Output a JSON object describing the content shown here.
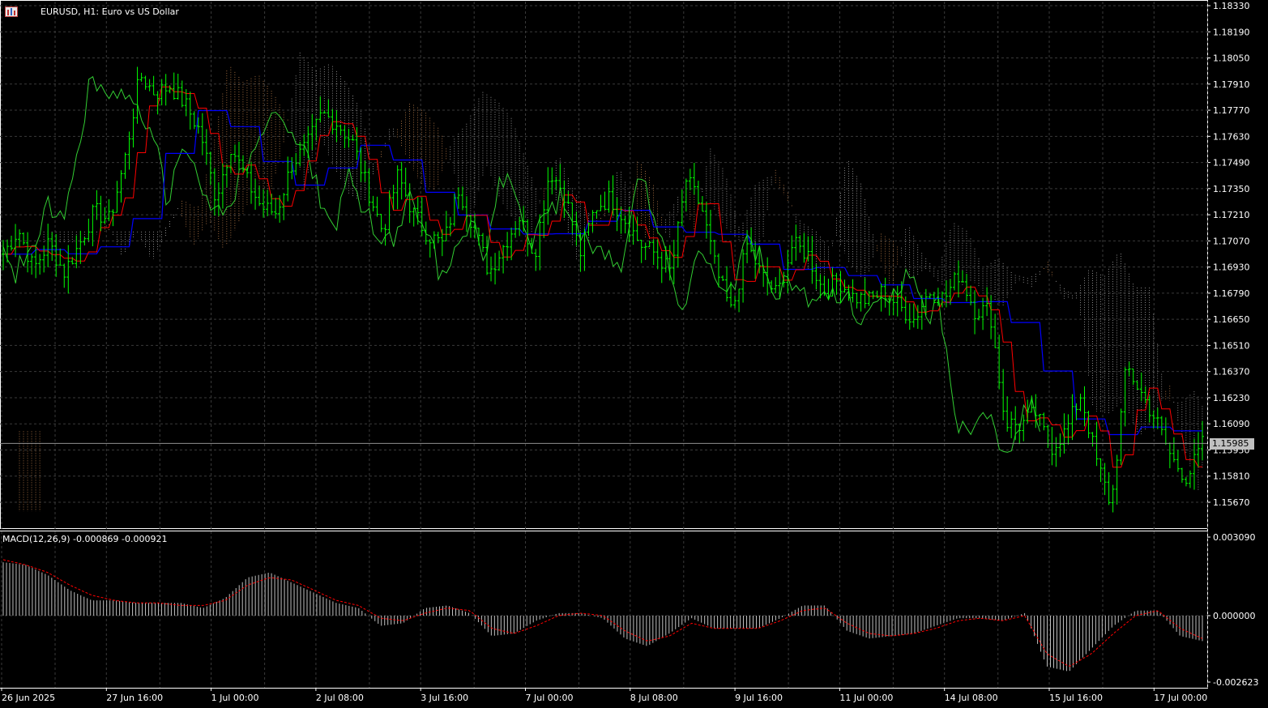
{
  "window": {
    "symbol_title": "EURUSD, H1:  Euro vs US Dollar",
    "icons": [
      "chart-window-icon",
      "bar-chart-icon"
    ]
  },
  "colors": {
    "background": "#000000",
    "grid": "#3a3a3a",
    "price": "#00ff00",
    "tenkan": "#ff0000",
    "kijun": "#0000ff",
    "chikou": "#32cd32",
    "cloud_a": "#f4a460",
    "cloud_b": "#d8d8d8",
    "macd_hist": "#c0c0c0",
    "macd_signal": "#ff0000",
    "axis_text": "#ffffff"
  },
  "macd": {
    "label": "MACD(12,26,9) -0.000869 -0.000921",
    "y_labels": [
      "0.003090",
      "0.000000",
      "-0.002623"
    ]
  },
  "current_price_tag": "1.15985",
  "chart_data": {
    "type": "candlestick",
    "symbol": "EURUSD",
    "timeframe": "H1",
    "title": "EURUSD, H1:  Euro vs US Dollar",
    "y_axis_labels": [
      "1.18330",
      "1.18190",
      "1.18050",
      "1.17910",
      "1.17770",
      "1.17630",
      "1.17490",
      "1.17350",
      "1.17210",
      "1.17070",
      "1.16930",
      "1.16790",
      "1.16650",
      "1.16510",
      "1.16370",
      "1.16230",
      "1.16090",
      "1.15950",
      "1.15810",
      "1.15670"
    ],
    "ylim": [
      1.1555,
      1.184
    ],
    "x_axis_labels": [
      "26 Jun 2025",
      "27 Jun 16:00",
      "1 Jul 00:00",
      "2 Jul 08:00",
      "3 Jul 16:00",
      "7 Jul 00:00",
      "8 Jul 08:00",
      "9 Jul 16:00",
      "11 Jul 00:00",
      "14 Jul 08:00",
      "15 Jul 16:00",
      "17 Jul 00:00"
    ],
    "current_price": 1.15985,
    "price_path": [
      1.17,
      1.1713,
      1.1692,
      1.1706,
      1.169,
      1.1705,
      1.1723,
      1.1718,
      1.175,
      1.1796,
      1.1786,
      1.179,
      1.178,
      1.1765,
      1.173,
      1.1758,
      1.174,
      1.1725,
      1.1722,
      1.1748,
      1.1758,
      1.1775,
      1.177,
      1.176,
      1.1735,
      1.1712,
      1.1742,
      1.1722,
      1.171,
      1.1705,
      1.1735,
      1.1715,
      1.169,
      1.1705,
      1.172,
      1.17,
      1.1745,
      1.1732,
      1.17,
      1.1725,
      1.173,
      1.1718,
      1.1705,
      1.17,
      1.169,
      1.174,
      1.1725,
      1.169,
      1.1668,
      1.1705,
      1.1688,
      1.1678,
      1.1705,
      1.17,
      1.168,
      1.1686,
      1.1677,
      1.1675,
      1.168,
      1.1672,
      1.1665,
      1.168,
      1.1676,
      1.169,
      1.167,
      1.167,
      1.161,
      1.1608,
      1.1615,
      1.1596,
      1.1605,
      1.1625,
      1.159,
      1.1565,
      1.164,
      1.1625,
      1.161,
      1.159,
      1.158,
      1.1598
    ],
    "macd_histogram": [
      0.0021,
      0.002,
      0.0016,
      0.001,
      0.0006,
      0.0006,
      0.0005,
      0.0005,
      0.0005,
      0.0003,
      0.0007,
      0.0015,
      0.0017,
      0.0013,
      0.0009,
      0.0005,
      0.0003,
      -0.0004,
      -0.0003,
      0.0003,
      0.0004,
      0.0001,
      -0.0008,
      -0.0007,
      -0.0002,
      0.0001,
      0.0001,
      -0.0001,
      -0.0009,
      -0.0012,
      -0.0007,
      -0.0001,
      -0.0005,
      -0.0005,
      -0.0005,
      -0.0001,
      0.0004,
      0.0004,
      -0.0006,
      -0.0009,
      -0.0008,
      -0.0007,
      -0.0004,
      -0.0001,
      -0.0001,
      -0.0002,
      0.0001,
      -0.002,
      -0.0022,
      -0.0013,
      -0.0004,
      0.0002,
      0.0002,
      -0.0008,
      -0.001
    ],
    "macd_signal": [
      0.0022,
      0.002,
      0.0017,
      0.0012,
      0.0008,
      0.0006,
      0.0005,
      0.0005,
      0.0004,
      0.0004,
      0.0006,
      0.0012,
      0.0015,
      0.0014,
      0.001,
      0.0006,
      0.0004,
      -0.0001,
      -0.0002,
      0.0001,
      0.0003,
      0.0002,
      -0.0005,
      -0.0007,
      -0.0004,
      0.0,
      0.0001,
      0.0,
      -0.0006,
      -0.001,
      -0.0008,
      -0.0003,
      -0.0005,
      -0.0005,
      -0.0005,
      -0.0002,
      0.0002,
      0.0003,
      -0.0003,
      -0.0007,
      -0.0008,
      -0.0007,
      -0.0005,
      -0.0002,
      -0.0001,
      -0.0002,
      0.0,
      -0.0015,
      -0.002,
      -0.0015,
      -0.0007,
      0.0,
      0.0002,
      -0.0005,
      -0.0009
    ]
  }
}
